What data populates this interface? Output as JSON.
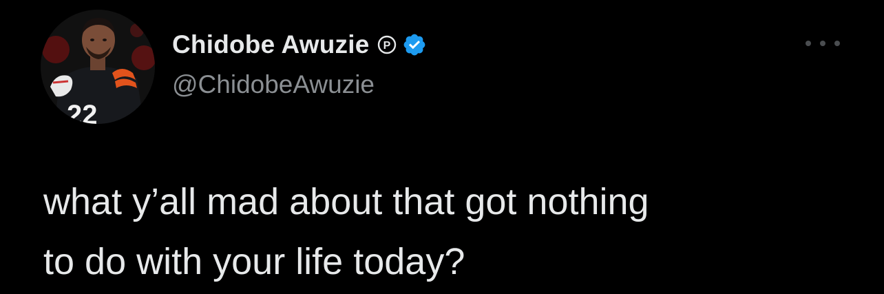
{
  "tweet": {
    "author": {
      "display_name": "Chidobe Awuzie",
      "handle": "@ChidobeAwuzie",
      "badges": [
        "professional-badge-icon",
        "verified-badge-icon"
      ],
      "verified_color": "#1d9bf0"
    },
    "menu_icon": "more-horizontal-icon",
    "text_line_1": "what y’all mad about that got nothing",
    "text_line_2": "to do with your life today?"
  },
  "theme": {
    "background": "#000000",
    "primary_text": "#e7e9ea",
    "secondary_text": "#71767b"
  }
}
